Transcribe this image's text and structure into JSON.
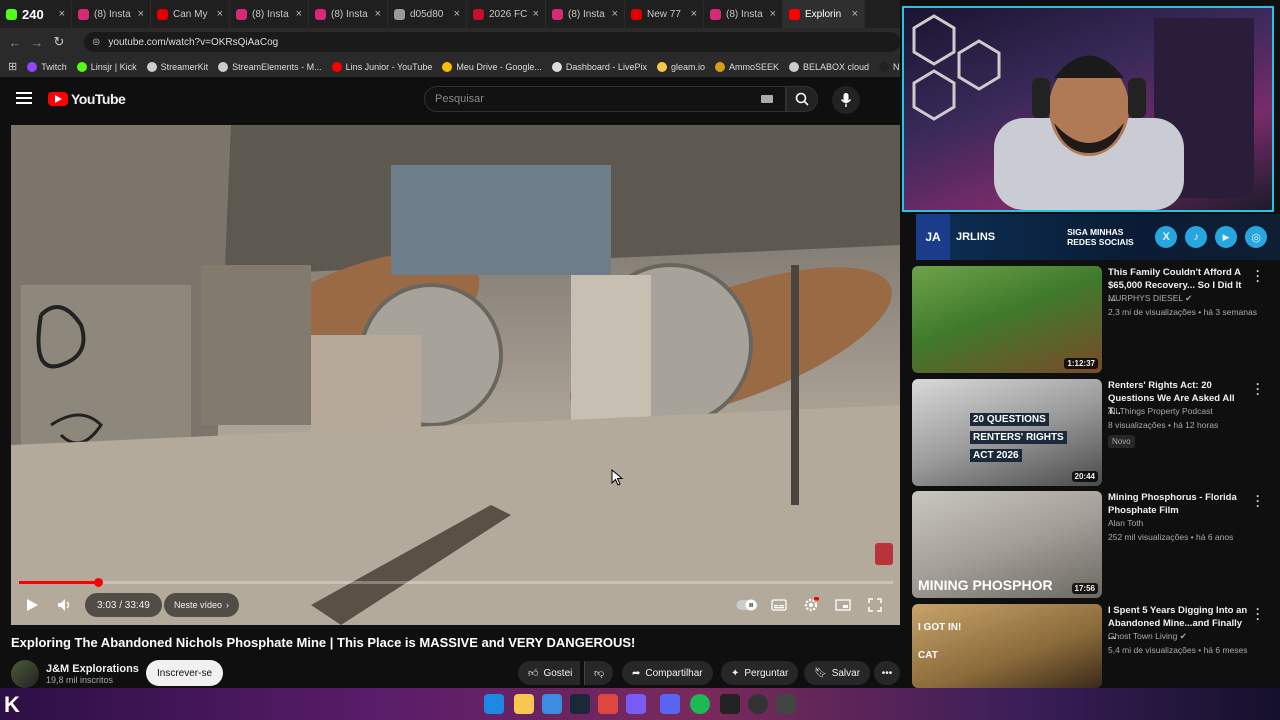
{
  "browser": {
    "tabs": [
      {
        "label": "240",
        "favicon_color": "#53fc18",
        "active": false
      },
      {
        "label": "(8) Insta",
        "favicon_color": "#d62976",
        "active": false
      },
      {
        "label": "Can My",
        "favicon_color": "#e00000",
        "active": false
      },
      {
        "label": "(8) Insta",
        "favicon_color": "#d62976",
        "active": false
      },
      {
        "label": "(8) Insta",
        "favicon_color": "#d62976",
        "active": false
      },
      {
        "label": "d05d80",
        "favicon_color": "#999999",
        "active": false
      },
      {
        "label": "2026 FC",
        "favicon_color": "#c8102e",
        "active": false
      },
      {
        "label": "(8) Insta",
        "favicon_color": "#d62976",
        "active": false
      },
      {
        "label": "New 77",
        "favicon_color": "#e00000",
        "active": false
      },
      {
        "label": "(8) Insta",
        "favicon_color": "#d62976",
        "active": false
      },
      {
        "label": "Explorin",
        "favicon_color": "#ff0000",
        "active": true
      }
    ],
    "url": "youtube.com/watch?v=OKRsQiAaCog",
    "bookmarks": [
      {
        "label": "Twitch",
        "color": "#9146ff"
      },
      {
        "label": "Linsjr | Kick",
        "color": "#53fc18"
      },
      {
        "label": "StreamerKit",
        "color": "#cccccc"
      },
      {
        "label": "StreamElements - M...",
        "color": "#cccccc"
      },
      {
        "label": "Lins Junior - YouTube",
        "color": "#ff0000"
      },
      {
        "label": "Meu Drive - Google...",
        "color": "#fbbc04"
      },
      {
        "label": "Dashboard - LivePix",
        "color": "#dddddd"
      },
      {
        "label": "gleam.io",
        "color": "#f7c948"
      },
      {
        "label": "AmmoSEEK",
        "color": "#d4a017"
      },
      {
        "label": "BELABOX cloud",
        "color": "#cccccc"
      },
      {
        "label": "Nightbot - Comm",
        "color": "#222222"
      }
    ]
  },
  "youtube": {
    "logo_text": "YouTube",
    "search_placeholder": "Pesquisar",
    "player": {
      "time_current": "3:03",
      "time_total": "33:49",
      "time_display": "3:03 / 33:49",
      "progress_fraction": 0.09,
      "chapters_label": "Neste vídeo"
    },
    "video_title": "Exploring The Abandoned Nichols Phosphate Mine | This Place is MASSIVE and VERY DANGEROUS!",
    "channel_name": "J&M Explorations",
    "subscribers": "19,8 mil inscritos",
    "subscribe_label": "Inscrever-se",
    "actions": {
      "like": "Gostei",
      "share": "Compartilhar",
      "ask": "Perguntar",
      "save": "Salvar"
    }
  },
  "overlay": {
    "brand": "JRLINS",
    "follow_text": "SIGA MINHAS REDES SOCIAIS"
  },
  "recommendations": [
    {
      "title": "This Family Couldn't Afford A $65,000 Recovery... So I Did It ...",
      "channel": "MURPHYS DIESEL",
      "verified": true,
      "meta": "2,3 mi de visualizações • há 3 semanas",
      "duration": "1:12:37"
    },
    {
      "title": "Renters' Rights Act: 20 Questions We Are Asked All T...",
      "channel": "All Things Property Podcast",
      "verified": false,
      "meta": "8 visualizações • há 12 horas",
      "badge": "Novo",
      "duration": "20:44",
      "thumb_text": [
        "20 QUESTIONS",
        "RENTERS' RIGHTS",
        "ACT 2026"
      ]
    },
    {
      "title": "Mining Phosphorus - Florida Phosphate Film",
      "channel": "Alan Toth",
      "verified": false,
      "meta": "252 mil visualizações • há 6 anos",
      "duration": "17:56",
      "thumb_text": [
        "MINING PHOSPHOR"
      ]
    },
    {
      "title": "I Spent 5 Years Digging Into an Abandoned Mine...and Finally ...",
      "channel": "Ghost Town Living",
      "verified": true,
      "meta": "5,4 mi de visualizações • há 6 meses",
      "thumb_text": [
        "I GOT IN!",
        "CAT"
      ]
    }
  ]
}
